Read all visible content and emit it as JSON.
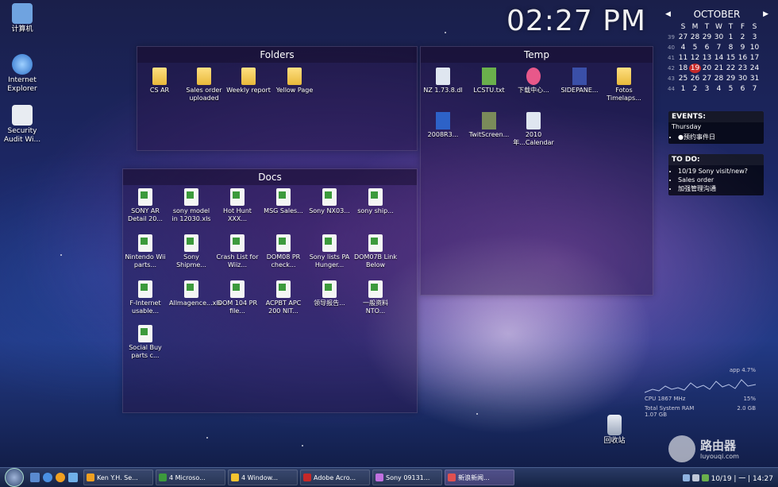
{
  "desktop": {
    "icons": [
      {
        "label": "计算机",
        "icon": "computer-icon",
        "color": "#6fa3e0"
      },
      {
        "label": "Internet Explorer",
        "icon": "ie-icon",
        "color": "#4a90e2"
      },
      {
        "label": "Security Audit Wi...",
        "icon": "document-icon",
        "color": "#e0e6ef"
      }
    ],
    "recycle_bin": "回收站"
  },
  "clock": {
    "time": "02:27 PM"
  },
  "fences": {
    "folders": {
      "title": "Folders",
      "items": [
        "CS AR",
        "Sales order uploaded",
        "Weekly report",
        "Yellow Page"
      ]
    },
    "temp": {
      "title": "Temp",
      "items": [
        "NZ 1.73.8.dl",
        "LCSTU.txt",
        "下载中心...",
        "SIDEPANE...",
        "Fotos Timelaps...",
        "2008R3...",
        "TwitScreen...",
        "2010年...Calendar"
      ]
    },
    "docs": {
      "title": "Docs",
      "items": [
        "SONY AR Detail 20...",
        "sony model in 12030.xls",
        "Hot Hunt XXX...",
        "MSG Sales...",
        "Sony NX03...",
        "sony ship...",
        "Nintendo Wii parts...",
        "Sony Shipme...",
        "Crash List for Wiiz...",
        "DOM08 PR check...",
        "Sony lists PA Hunger...",
        "DOM07B Link Below",
        "F-Internet usable...",
        "Allmagence...xls",
        "DOM 104 PR file...",
        "ACPBT APC 200 NIT...",
        "领导报告...",
        "一般资料 NTO..."
      ],
      "last": "Social Buy parts c..."
    }
  },
  "calendar": {
    "month": "OCTOBER",
    "prev": "◀",
    "next": "▶",
    "days": [
      "S",
      "M",
      "T",
      "W",
      "T",
      "F",
      "S"
    ],
    "weeks": [
      [
        "39",
        "27",
        "28",
        "29",
        "30",
        "1",
        "2",
        "3"
      ],
      [
        "40",
        "4",
        "5",
        "6",
        "7",
        "8",
        "9",
        "10"
      ],
      [
        "41",
        "11",
        "12",
        "13",
        "14",
        "15",
        "16",
        "17"
      ],
      [
        "42",
        "18",
        "19",
        "20",
        "21",
        "22",
        "23",
        "24"
      ],
      [
        "43",
        "25",
        "26",
        "27",
        "28",
        "29",
        "30",
        "31"
      ],
      [
        "44",
        "1",
        "2",
        "3",
        "4",
        "5",
        "6",
        "7"
      ]
    ],
    "today": "19"
  },
  "events": {
    "title": "EVENTS:",
    "day": "Thursday",
    "items": [
      "●预约事件日"
    ]
  },
  "todo": {
    "title": "TO DO:",
    "items": [
      "10/19 Sony visit/new?",
      "Sales order",
      "加强管理沟通"
    ]
  },
  "cpu": {
    "label": "CPU 1867 MHz",
    "percent": "15%",
    "sys": "Total System RAM",
    "ram_total": "2.0 GB",
    "ram_used": "1.07 GB",
    "value": "app 4.7%"
  },
  "taskbar": {
    "tasks": [
      {
        "label": "Ken Y.H. Se...",
        "color": "#f0a020"
      },
      {
        "label": "4 Microso...",
        "color": "#3c9a3c"
      },
      {
        "label": "4 Window...",
        "color": "#f4c430"
      },
      {
        "label": "Adobe Acro...",
        "color": "#c62828"
      },
      {
        "label": "Sony 09131...",
        "color": "#c070e0"
      },
      {
        "label": "新浪新闻...",
        "color": "#e05050"
      }
    ],
    "tray_time": "10/19 | 一 | 14:27"
  },
  "watermark": {
    "text": "路由器",
    "sub": "luyouqi.com"
  }
}
